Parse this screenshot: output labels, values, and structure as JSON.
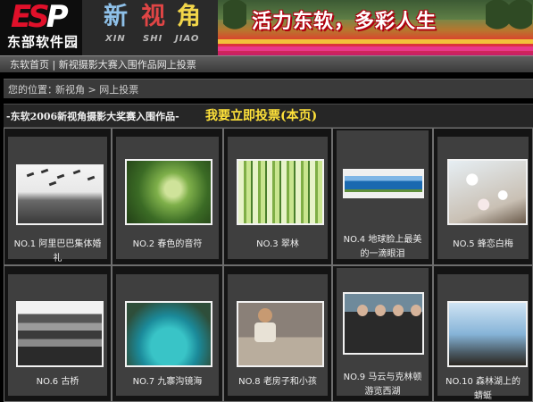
{
  "header": {
    "logo_mark": "ESP",
    "site_name": "东部软件园",
    "column_chars": [
      "新",
      "视",
      "角"
    ],
    "column_pinyin": [
      "XIN",
      "SHI",
      "JIAO"
    ],
    "banner_slogan": "活力东软，多彩人生"
  },
  "topnav": {
    "text": "东软首页 | 新视摄影大赛入围作品网上投票"
  },
  "location": {
    "label": "您的位置：",
    "path": "新视角 > 网上投票"
  },
  "section": {
    "title": "-东软2006新视角摄影大奖赛入围作品-",
    "vote_link": "我要立即投票(本页)"
  },
  "entries": [
    {
      "caption": "NO.1 阿里巴巴集体婚礼",
      "photo": "wedding"
    },
    {
      "caption": "NO.2 春色的音符",
      "photo": "vine"
    },
    {
      "caption": "NO.3 翠林",
      "photo": "forest"
    },
    {
      "caption": "NO.4 地球脸上最美的一滴眼泪",
      "photo": "lake"
    },
    {
      "caption": "NO.5 蜂恋白梅",
      "photo": "plum"
    },
    {
      "caption": "NO.6 古桥",
      "photo": "bridge"
    },
    {
      "caption": "NO.7 九寨沟镜海",
      "photo": "jiuzhai"
    },
    {
      "caption": "NO.8 老房子和小孩",
      "photo": "kid"
    },
    {
      "caption": "NO.9 马云与克林顿游览西湖",
      "photo": "mayun"
    },
    {
      "caption": "NO.10 森林湖上的蜻蜓",
      "photo": "dragonfly"
    }
  ],
  "colors": {
    "page_bg": "#000000",
    "card_bg": "#3f3f3f",
    "vote_link": "#ffe23a",
    "logo_red": "#e0102a"
  }
}
